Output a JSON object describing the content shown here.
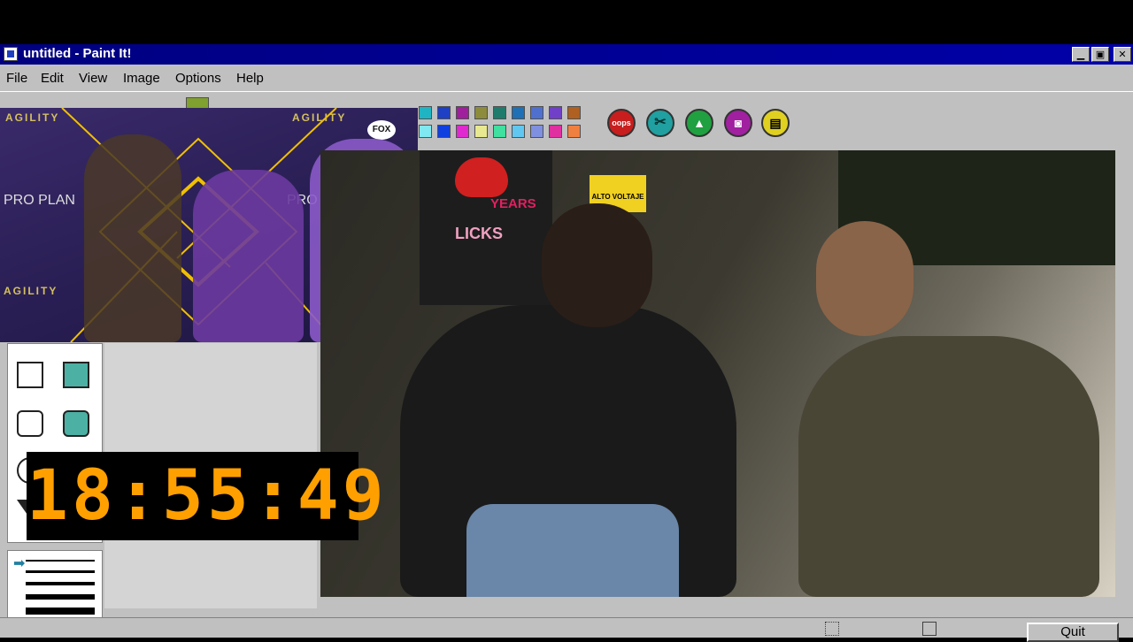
{
  "window": {
    "title": "untitled - Paint It!",
    "controls": {
      "minimize": "▁",
      "maximize": "▣",
      "close": "✕"
    }
  },
  "menu": [
    {
      "label": "File"
    },
    {
      "label": "Edit"
    },
    {
      "label": "View"
    },
    {
      "label": "Image"
    },
    {
      "label": "Options"
    },
    {
      "label": "Help"
    }
  ],
  "palette": {
    "row1": [
      "#1fb4c4",
      "#1f40c4",
      "#a01f9c",
      "#8c8c3c",
      "#1f7c6c",
      "#1f70b4",
      "#5070d0",
      "#7040c8",
      "#b06020"
    ],
    "row2": [
      "#80e8f0",
      "#1040e0",
      "#e02ad0",
      "#e8e890",
      "#40e0a0",
      "#60c8f0",
      "#8090e0",
      "#e030a0",
      "#f08040"
    ]
  },
  "action_buttons": [
    {
      "name": "oops-button",
      "label": "oops",
      "color": "#c81e1e"
    },
    {
      "name": "scissors-button",
      "label": "",
      "color": "#20a0a0"
    },
    {
      "name": "stamp-button",
      "label": "",
      "color": "#20a040"
    },
    {
      "name": "bucket-button",
      "label": "",
      "color": "#a020a0"
    },
    {
      "name": "printer-button",
      "label": "",
      "color": "#e0d020"
    }
  ],
  "overlay_cam": {
    "brand_text": "AGILITY",
    "sponsor_text": "PRO PLAN",
    "network": "FOX"
  },
  "main_cam": {
    "poster_text": "LICKS",
    "poster_text2": "YEARS",
    "sign_text": "ALTO VOLTAJE"
  },
  "clock": {
    "time": "18:55:49"
  },
  "status": {
    "quit_label": "Quit"
  }
}
